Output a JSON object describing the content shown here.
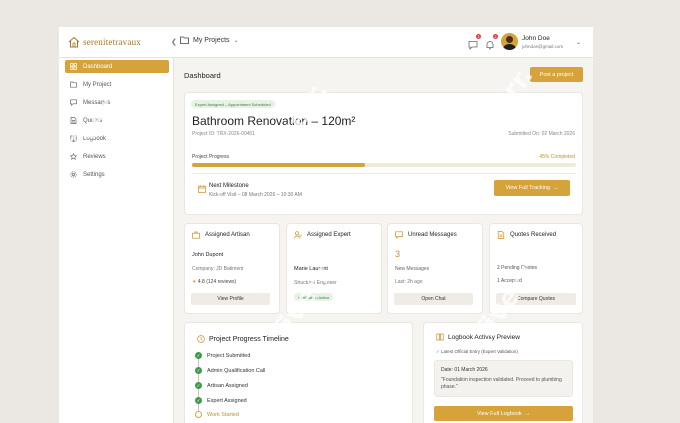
{
  "brand": {
    "name": "serenitetravaux"
  },
  "topbar": {
    "project_selector": "My Projects",
    "messages_badge": "2",
    "notifications_badge": "2",
    "user_name": "John Doe",
    "user_email": "johndoe@gmail.com"
  },
  "sidebar": {
    "items": [
      {
        "label": "Dashboard",
        "icon": "grid-icon"
      },
      {
        "label": "My Project",
        "icon": "folder-icon"
      },
      {
        "label": "Messages",
        "icon": "chat-icon"
      },
      {
        "label": "Quotes",
        "icon": "document-icon"
      },
      {
        "label": "Logbook",
        "icon": "book-icon"
      },
      {
        "label": "Reviews",
        "icon": "star-icon"
      },
      {
        "label": "Settings",
        "icon": "gear-icon"
      }
    ]
  },
  "main": {
    "title": "Dashboard",
    "post_button": "Post a project",
    "hero": {
      "badge": "Expert Assigned – Appointment Scheduled",
      "title": "Bathroom Renovation – 120m²",
      "project_id": "Project ID: TRX-2026-00451",
      "submitted": "Submitted On: 02 March 2026",
      "progress_label": "Project Progress",
      "progress_text": "45% Completed",
      "progress_fraction": 0.45,
      "milestone_title": "Next Milestone",
      "milestone_sub": "Kick-off Visit – 08 March 2026 – 10:30 AM",
      "track_button": "View Full Tracking"
    },
    "artisan": {
      "title": "Assigned Artisan",
      "name": "John Dupont",
      "company": "Company: JD Batiment",
      "rating": "4.8 (124 reviews)",
      "button": "View Profile"
    },
    "expert": {
      "title": "Assigned Expert",
      "name": "Marie Laurent",
      "role": "Structural Engineer",
      "status": "Verification Active"
    },
    "messages": {
      "title": "Unread Messages",
      "count": "3",
      "label": "New Messages",
      "last": "Last: 2h ago",
      "button": "Open Chat"
    },
    "quotes": {
      "title": "Quotes Received",
      "pending": "2 Pending Quotes",
      "accepted": "1 Accepted",
      "button": "Compare Quotes"
    },
    "timeline": {
      "title": "Project Progress Timeline",
      "items": [
        {
          "label": "Project Submitted",
          "done": true
        },
        {
          "label": "Admin Qualification Call",
          "done": true
        },
        {
          "label": "Artisan Assigned",
          "done": true
        },
        {
          "label": "Expert Assigned",
          "done": true
        },
        {
          "label": "Work Started",
          "done": false
        }
      ]
    },
    "logbook": {
      "title": "Logbook Activity Preview",
      "latest": "Latest Official Entry (Expert Validation)",
      "date": "Date: 01 March 2026",
      "note": "\"Foundation inspection validated. Proceed to plumbing phase.\"",
      "button": "View Full Logbook"
    }
  },
  "watermark": {
    "text": "fiverr."
  },
  "colors": {
    "accent": "#d6a23a",
    "success": "#3f9a4b",
    "badge_alert": "#e04040"
  }
}
